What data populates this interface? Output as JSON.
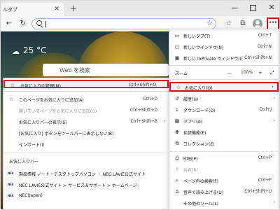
{
  "titlebar": {
    "tab_title": "ルタブ",
    "tab_close": "✕",
    "new_tab": "+",
    "close": "✕"
  },
  "toolbar": {
    "back": "←",
    "refresh": "↻",
    "address_star": "☆",
    "favorites": "☆",
    "collections": "⧉",
    "more": "···"
  },
  "page": {
    "weather_icon": "☁",
    "temperature": "25 °C",
    "search_placeholder": "Web を検索"
  },
  "favorites_menu": {
    "items": [
      {
        "icon": "☆",
        "label": "お気に入りの管理(M)",
        "shortcut": "Ctrl+Shift+O",
        "highlighted": true
      },
      {
        "icon": "☆",
        "label": "このページをお気に入りに追加(A)",
        "shortcut": "Ctrl+D"
      },
      {
        "icon": "",
        "label": "開いているページをお気に入りに追加(O)",
        "shortcut": "Ctrl+Shift+D",
        "disabled": true
      },
      {
        "icon": "",
        "label": "お気に入りバーの表示(S)",
        "shortcut": "Ctrl+Shift+B",
        "arrow": "›"
      },
      {
        "icon": "",
        "label": "[お気に入り] ボタンをツールバーに表示しない(B)",
        "shortcut": ""
      },
      {
        "icon": "",
        "label": "インポート(I)",
        "shortcut": ""
      }
    ],
    "bar_heading": "お気に入りバー",
    "bar_items": [
      {
        "logo": "NEC",
        "label": "製品情報 ノート・デスクトップパソコン ｜ NEC LAVIE公式サイト"
      },
      {
        "logo": "NEC",
        "label": "NEC LAVIE公式サイト > サービス＆サポート > ホームページ"
      },
      {
        "logo": "NEC",
        "label": "NEC(Japan)"
      }
    ]
  },
  "main_menu": {
    "items_top": [
      {
        "icon": "▭",
        "label": "新しいタブ(T)",
        "shortcut": "Ctrl+T"
      },
      {
        "icon": "▢",
        "label": "新しいウインドウ(N)",
        "shortcut": "Ctrl+N"
      },
      {
        "icon": "▣",
        "label": "新しい InPrivate ウィンドウ(I)",
        "shortcut": "Ctrl+Shift+N"
      }
    ],
    "zoom": {
      "label": "ズーム",
      "minus": "—",
      "value": "100%",
      "plus": "+",
      "fullscreen": "⤢"
    },
    "items_mid": [
      {
        "icon": "☆",
        "label": "お気に入り(O)",
        "shortcut": "",
        "arrow": "›",
        "highlighted": true
      },
      {
        "icon": "↺",
        "label": "履歴(H)",
        "shortcut": "",
        "arrow": "›"
      },
      {
        "icon": "↓",
        "label": "ダウンロード(D)",
        "shortcut": "Ctrl+J"
      },
      {
        "icon": "▦",
        "label": "アプリ(A)",
        "shortcut": "",
        "arrow": "›"
      },
      {
        "icon": "✚",
        "label": "拡張機能(E)",
        "shortcut": ""
      },
      {
        "icon": "⧉",
        "label": "コレクション(E)",
        "shortcut": ""
      }
    ],
    "items_bottom": [
      {
        "icon": "⎙",
        "label": "印刷(P)",
        "shortcut": "Ctrl+P"
      },
      {
        "icon": "⇪",
        "label": "共有(R)",
        "shortcut": "",
        "disabled": true
      },
      {
        "icon": "⌕",
        "label": "ページ内の検索(F)",
        "shortcut": "Ctrl+F"
      },
      {
        "icon": "A",
        "label": "音声で読み上げる(U)",
        "shortcut": "Ctrl+Shift+U"
      },
      {
        "icon": "",
        "label": "その他のツール(L)",
        "shortcut": "",
        "arrow": "›"
      }
    ]
  }
}
